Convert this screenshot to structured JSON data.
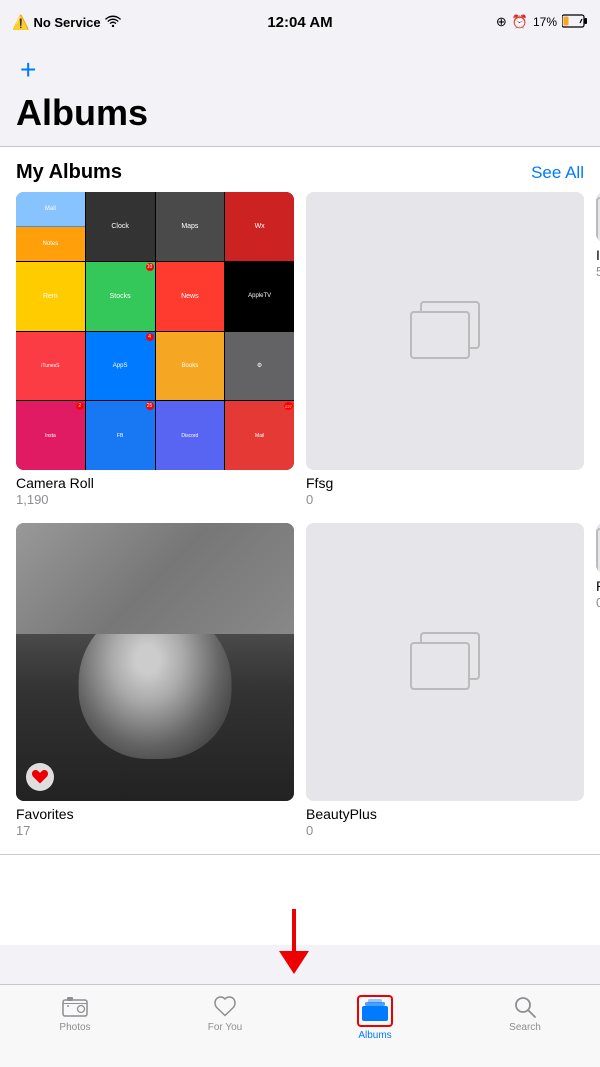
{
  "statusBar": {
    "noService": "No Service",
    "time": "12:04 AM",
    "percent": "17%",
    "wifiOn": true
  },
  "header": {
    "addLabel": "+",
    "title": "Albums"
  },
  "myAlbums": {
    "sectionTitle": "My Albums",
    "seeAll": "See All",
    "albums": [
      {
        "name": "Camera Roll",
        "count": "1,190",
        "hasPhoto": true,
        "type": "cameraroll"
      },
      {
        "name": "Ffsg",
        "count": "0",
        "hasPhoto": false,
        "type": "empty"
      },
      {
        "name": "Ir",
        "count": "5",
        "hasPhoto": false,
        "type": "partial",
        "partial": true
      },
      {
        "name": "Favorites",
        "count": "17",
        "hasPhoto": true,
        "type": "favorites"
      },
      {
        "name": "BeautyPlus",
        "count": "0",
        "hasPhoto": false,
        "type": "empty"
      },
      {
        "name": "P",
        "count": "0",
        "hasPhoto": false,
        "type": "partial",
        "partial": true
      }
    ]
  },
  "tabBar": {
    "tabs": [
      {
        "id": "photos",
        "label": "Photos",
        "active": false
      },
      {
        "id": "for-you",
        "label": "For You",
        "active": false
      },
      {
        "id": "albums",
        "label": "Albums",
        "active": true
      },
      {
        "id": "search",
        "label": "Search",
        "active": false
      }
    ]
  }
}
